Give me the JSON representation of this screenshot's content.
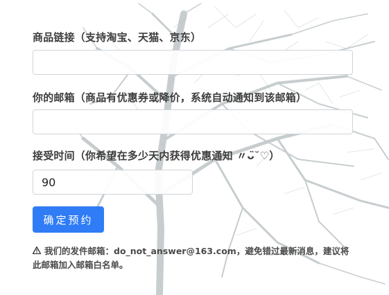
{
  "form": {
    "product_link_label": "商品链接（支持淘宝、天猫、京东）",
    "product_link_value": "",
    "email_label": "你的邮箱（商品有优惠券或降价，系统自动通知到该邮箱）",
    "email_value": "",
    "time_label": "接受时间（你希望在多少天内获得优惠通知 〃ᴗ̈˘♡）",
    "time_value": "90",
    "submit_label": "确定预约"
  },
  "notice": {
    "icon": "warning-icon",
    "text": "我们的发件邮箱：do_not_answer@163.com，避免错过最新消息，建议将此邮箱加入邮箱白名单。"
  },
  "colors": {
    "accent": "#2f7cf6",
    "label": "#3d3d3d",
    "border": "#cfd4d9"
  }
}
